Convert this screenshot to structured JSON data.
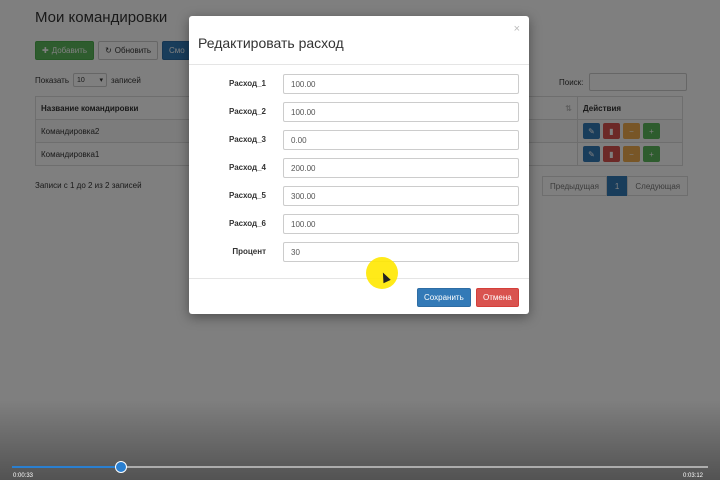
{
  "background_page": {
    "title": "Мои командировки",
    "toolbar": {
      "add_label": "Добавить",
      "refresh_label": "Обновить",
      "third_label": "Смо",
      "delete_label": ""
    },
    "show": {
      "label_before": "Показать",
      "value": "10",
      "label_after": "записей"
    },
    "search": {
      "label": "Поиск:"
    },
    "table": {
      "columns": [
        "Название командировки",
        "",
        "Действия"
      ],
      "rows": [
        {
          "name": "Командировка2"
        },
        {
          "name": "Командировка1"
        }
      ]
    },
    "info": "Записи с 1 до 2 из 2 записей",
    "pagination": {
      "prev": "Предыдущая",
      "current": "1",
      "next": "Следующая"
    }
  },
  "modal": {
    "title": "Редактировать расход",
    "close_symbol": "×",
    "fields": [
      {
        "label": "Расход_1",
        "value": "100.00"
      },
      {
        "label": "Расход_2",
        "value": "100.00"
      },
      {
        "label": "Расход_3",
        "value": "0.00"
      },
      {
        "label": "Расход_4",
        "value": "200.00"
      },
      {
        "label": "Расход_5",
        "value": "300.00"
      },
      {
        "label": "Расход_6",
        "value": "100.00"
      },
      {
        "label": "Процент",
        "value": "30"
      }
    ],
    "save_label": "Сохранить",
    "cancel_label": "Отмена"
  },
  "video": {
    "progress": 0.155,
    "current_time": "0:00:33",
    "total_time": "0:03:12",
    "accent": "#2a7fd0"
  },
  "colors": {
    "primary": "#337ab7",
    "success": "#5cb85c",
    "danger": "#d9534f",
    "warning": "#f0ad4e"
  }
}
